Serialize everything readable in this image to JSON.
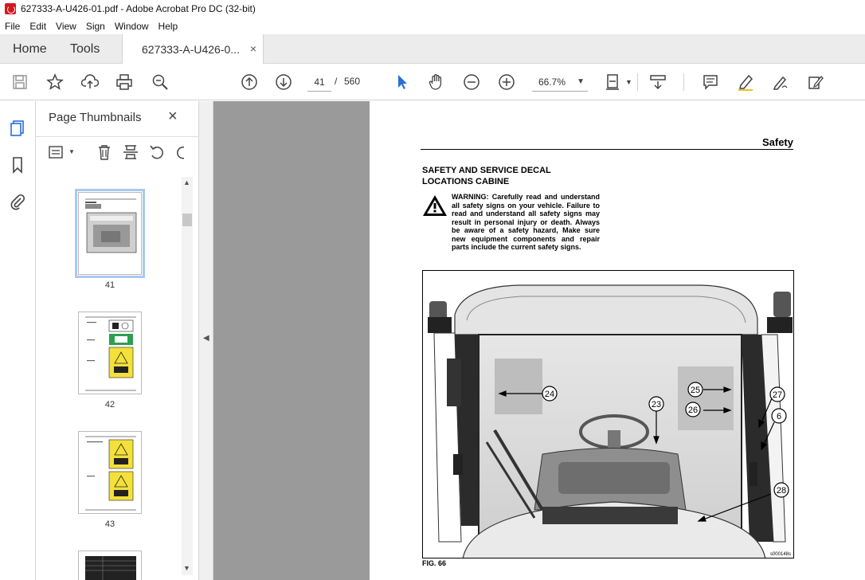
{
  "window": {
    "title": "627333-A-U426-01.pdf - Adobe Acrobat Pro DC (32-bit)"
  },
  "menu": [
    "File",
    "Edit",
    "View",
    "Sign",
    "Window",
    "Help"
  ],
  "tabs": {
    "home": "Home",
    "tools": "Tools",
    "doc": "627333-A-U426-0...",
    "close": "×"
  },
  "toolbar": {
    "page_current": "41",
    "page_sep": "/",
    "page_total": "560",
    "zoom": "66.7%",
    "icons": [
      "save-icon",
      "bookmark-star-icon",
      "upload-icon",
      "print-icon",
      "search-zoom-icon",
      "page-up-icon",
      "page-down-icon",
      "select-pointer-icon",
      "hand-icon",
      "zoom-out-icon",
      "zoom-in-icon",
      "fit-page-icon",
      "scroll-mode-icon",
      "comment-icon",
      "highlight-icon",
      "sign-icon",
      "edit-pdf-icon"
    ]
  },
  "thumbnail_panel": {
    "title": "Page Thumbnails",
    "close": "×",
    "thumbs": [
      {
        "num": "41",
        "selected": true
      },
      {
        "num": "42",
        "selected": false
      },
      {
        "num": "43",
        "selected": false
      }
    ]
  },
  "page": {
    "header": "Safety",
    "section_line1": "SAFETY AND SERVICE DECAL",
    "section_line2": "LOCATIONS CABINE",
    "warning": "WARNING: Carefully read and understand all safety signs on your vehicle. Failure to read and understand all safety signs may result in personal injury or death. Always be aware of a safety hazard, Make sure new equipment components and repair parts include the current safety signs.",
    "fig_caption": "FIG. 66",
    "fig_code": "s000148s",
    "callouts": [
      "24",
      "23",
      "25",
      "26",
      "27",
      "6",
      "28"
    ]
  }
}
